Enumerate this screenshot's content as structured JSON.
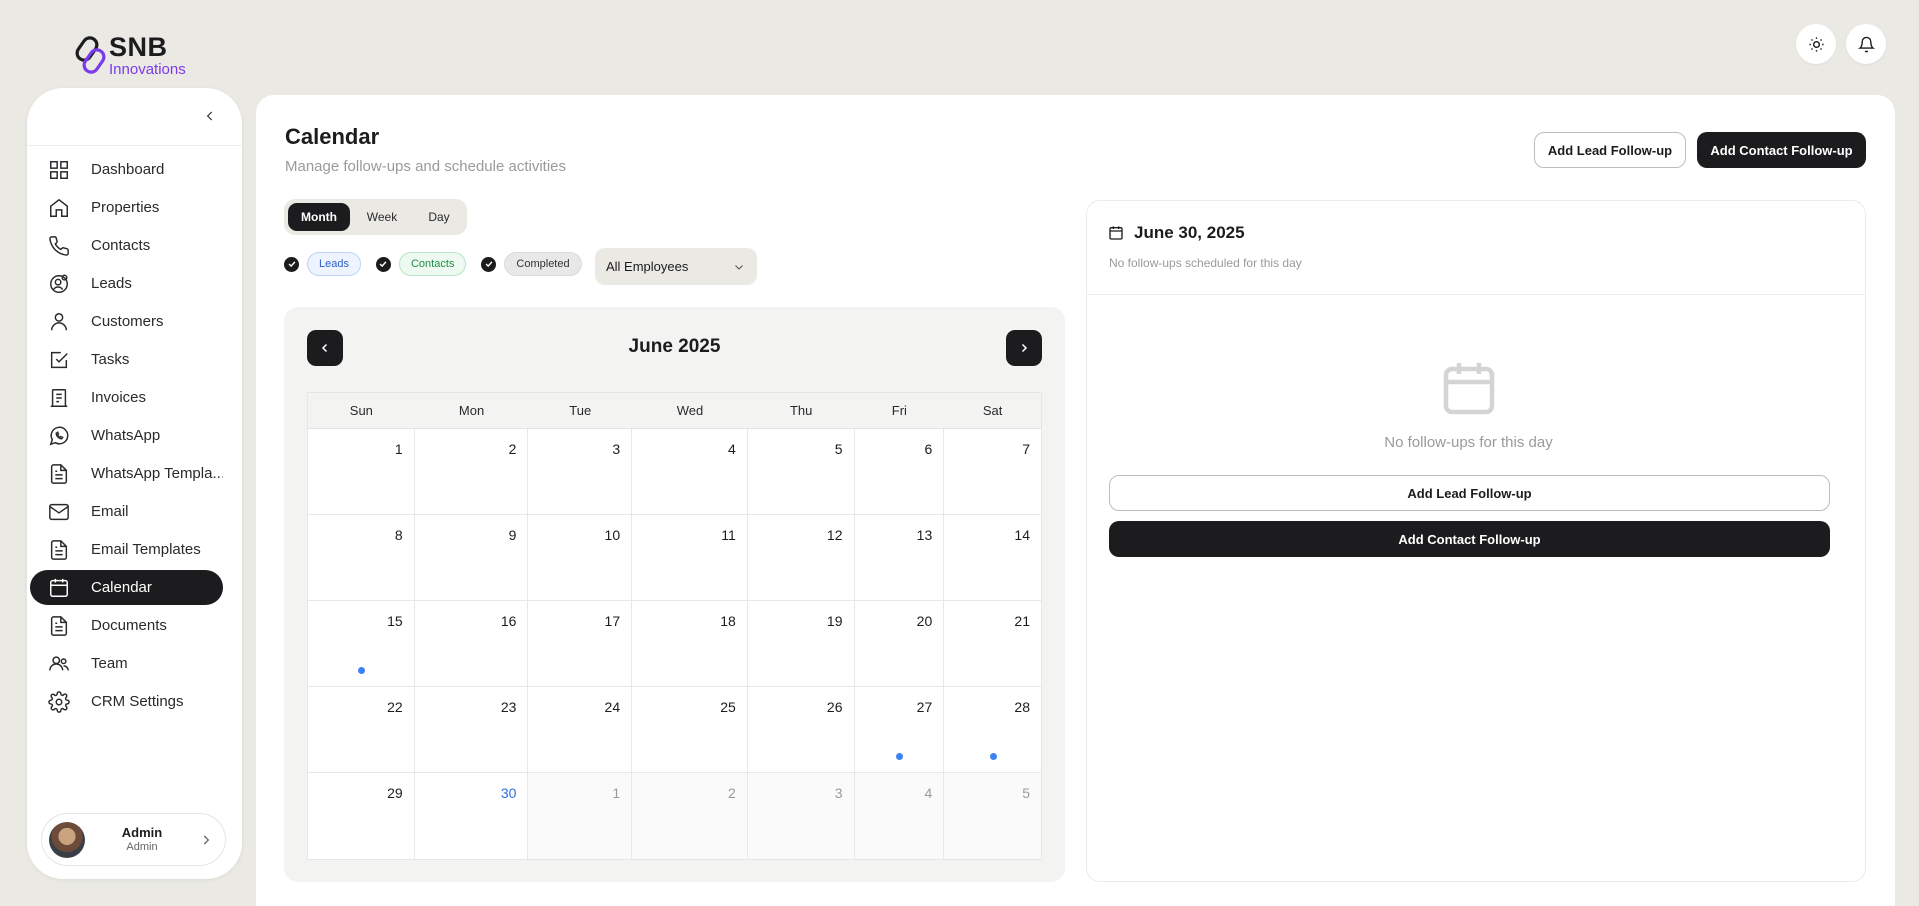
{
  "brand": {
    "name": "SNB",
    "sub": "Innovations",
    "accent": "#7c3aed"
  },
  "topbar": {
    "theme_icon": "sun-icon",
    "notifications_icon": "bell-icon"
  },
  "sidebar": {
    "items": [
      {
        "label": "Dashboard",
        "icon": "grid-icon"
      },
      {
        "label": "Properties",
        "icon": "home-icon"
      },
      {
        "label": "Contacts",
        "icon": "phone-icon"
      },
      {
        "label": "Leads",
        "icon": "users-target-icon"
      },
      {
        "label": "Customers",
        "icon": "user-icon"
      },
      {
        "label": "Tasks",
        "icon": "checkbox-icon"
      },
      {
        "label": "Invoices",
        "icon": "receipt-icon"
      },
      {
        "label": "WhatsApp",
        "icon": "whatsapp-icon"
      },
      {
        "label": "WhatsApp Templa...",
        "icon": "document-icon"
      },
      {
        "label": "Email",
        "icon": "mail-icon"
      },
      {
        "label": "Email Templates",
        "icon": "document-icon"
      },
      {
        "label": "Calendar",
        "icon": "calendar-icon",
        "active": true
      },
      {
        "label": "Documents",
        "icon": "document-icon"
      },
      {
        "label": "Team",
        "icon": "team-icon"
      },
      {
        "label": "CRM Settings",
        "icon": "gear-icon"
      }
    ],
    "user": {
      "name": "Admin",
      "role": "Admin"
    }
  },
  "page": {
    "title": "Calendar",
    "subtitle": "Manage follow-ups and schedule activities",
    "add_lead_label": "Add Lead Follow-up",
    "add_contact_label": "Add Contact Follow-up"
  },
  "views": {
    "options": [
      "Month",
      "Week",
      "Day"
    ],
    "selected": "Month"
  },
  "filters": {
    "leads": "Leads",
    "contacts": "Contacts",
    "completed": "Completed",
    "employee_select": "All Employees"
  },
  "calendar": {
    "month_title": "June 2025",
    "weekdays": [
      "Sun",
      "Mon",
      "Tue",
      "Wed",
      "Thu",
      "Fri",
      "Sat"
    ],
    "weeks": [
      [
        {
          "d": "1"
        },
        {
          "d": "2"
        },
        {
          "d": "3"
        },
        {
          "d": "4"
        },
        {
          "d": "5"
        },
        {
          "d": "6"
        },
        {
          "d": "7"
        }
      ],
      [
        {
          "d": "8"
        },
        {
          "d": "9"
        },
        {
          "d": "10"
        },
        {
          "d": "11"
        },
        {
          "d": "12"
        },
        {
          "d": "13"
        },
        {
          "d": "14"
        }
      ],
      [
        {
          "d": "15",
          "dot": true
        },
        {
          "d": "16"
        },
        {
          "d": "17"
        },
        {
          "d": "18"
        },
        {
          "d": "19"
        },
        {
          "d": "20"
        },
        {
          "d": "21"
        }
      ],
      [
        {
          "d": "22"
        },
        {
          "d": "23"
        },
        {
          "d": "24"
        },
        {
          "d": "25"
        },
        {
          "d": "26"
        },
        {
          "d": "27",
          "dot": true
        },
        {
          "d": "28",
          "dot": true
        }
      ],
      [
        {
          "d": "29"
        },
        {
          "d": "30",
          "today": true
        },
        {
          "d": "1",
          "other": true
        },
        {
          "d": "2",
          "other": true
        },
        {
          "d": "3",
          "other": true
        },
        {
          "d": "4",
          "other": true
        },
        {
          "d": "5",
          "other": true
        }
      ]
    ],
    "event_dot_color": "#3b82f6"
  },
  "detail": {
    "date": "June 30, 2025",
    "subtitle": "No follow-ups scheduled for this day",
    "empty_text": "No follow-ups for this day",
    "add_lead_label": "Add Lead Follow-up",
    "add_contact_label": "Add Contact Follow-up"
  }
}
